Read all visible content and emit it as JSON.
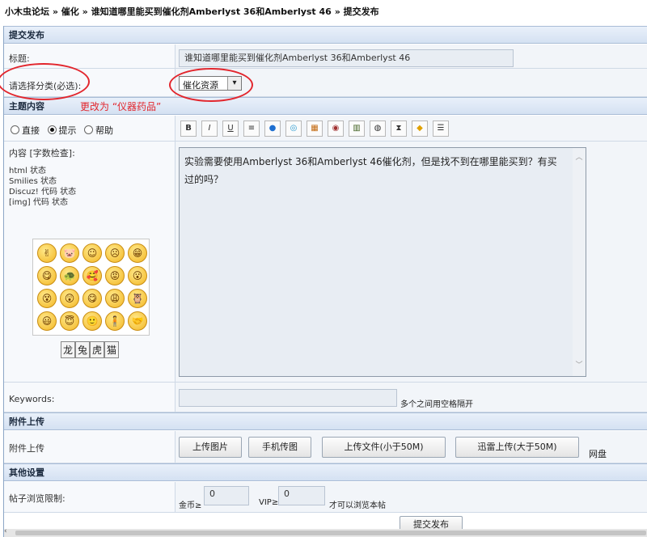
{
  "breadcrumb": {
    "forum": "小木虫论坛",
    "sep1": "»",
    "section": "催化",
    "sep2": "»",
    "thread": "谁知道哪里能买到催化剂Amberlyst 36和Amberlyst 46",
    "sep3": "»",
    "page": "提交发布"
  },
  "form": {
    "header": "提交发布",
    "title_label": "标题:",
    "title_value": "谁知道哪里能买到催化剂Amberlyst 36和Amberlyst 46",
    "category_label": "请选择分类(必选):",
    "category_selected": "催化资源",
    "annotation": "更改为 “仪器药品”"
  },
  "content": {
    "header": "主题内容",
    "modes": [
      "直接",
      "提示",
      "帮助"
    ],
    "mode_selected": "提示",
    "label": "内容 [字数检查]:",
    "status_lines": [
      "html 状态",
      "Smilies 状态",
      "Discuz! 代码 状态",
      "[img] 代码 状态"
    ],
    "toolbar": [
      "B",
      "I",
      "U",
      "≡",
      "●",
      "◎",
      "▦",
      "◉",
      "▥",
      "◍",
      "⧗",
      "◆",
      "☰"
    ],
    "body_text": "实验需要使用Amberlyst 36和Amberlyst 46催化剂，但是找不到在哪里能买到？有买过的吗？",
    "smilies": [
      "✌",
      "🐷",
      "☺",
      "☹",
      "😁",
      "😋",
      "🐢",
      "🥰",
      "😡",
      "😮",
      "😵",
      "😲",
      "😋",
      "😩",
      "🦉",
      "😃",
      "😇",
      "🙂",
      "🧍",
      "🤝"
    ],
    "smiley_tabs": [
      "龙",
      "兔",
      "虎",
      "猫"
    ]
  },
  "keywords": {
    "label": "Keywords:",
    "hint": "多个之间用空格隔开"
  },
  "attachments": {
    "header": "附件上传",
    "label": "附件上传",
    "buttons": [
      "上传图片",
      "手机传图",
      "上传文件(小于50M)",
      "迅雷上传(大于50M)"
    ],
    "extra": "网盘"
  },
  "other": {
    "header": "其他设置",
    "label": "帖子浏览限制:",
    "gold_label": "金币≥",
    "gold_value": "0",
    "vip_label": "VIP≥",
    "vip_value": "0",
    "suffix": "才可以浏览本帖"
  },
  "submit_label": "提交发布",
  "colors": {
    "header_bg": "#d4e1f2",
    "annotation": "#e2262d"
  }
}
